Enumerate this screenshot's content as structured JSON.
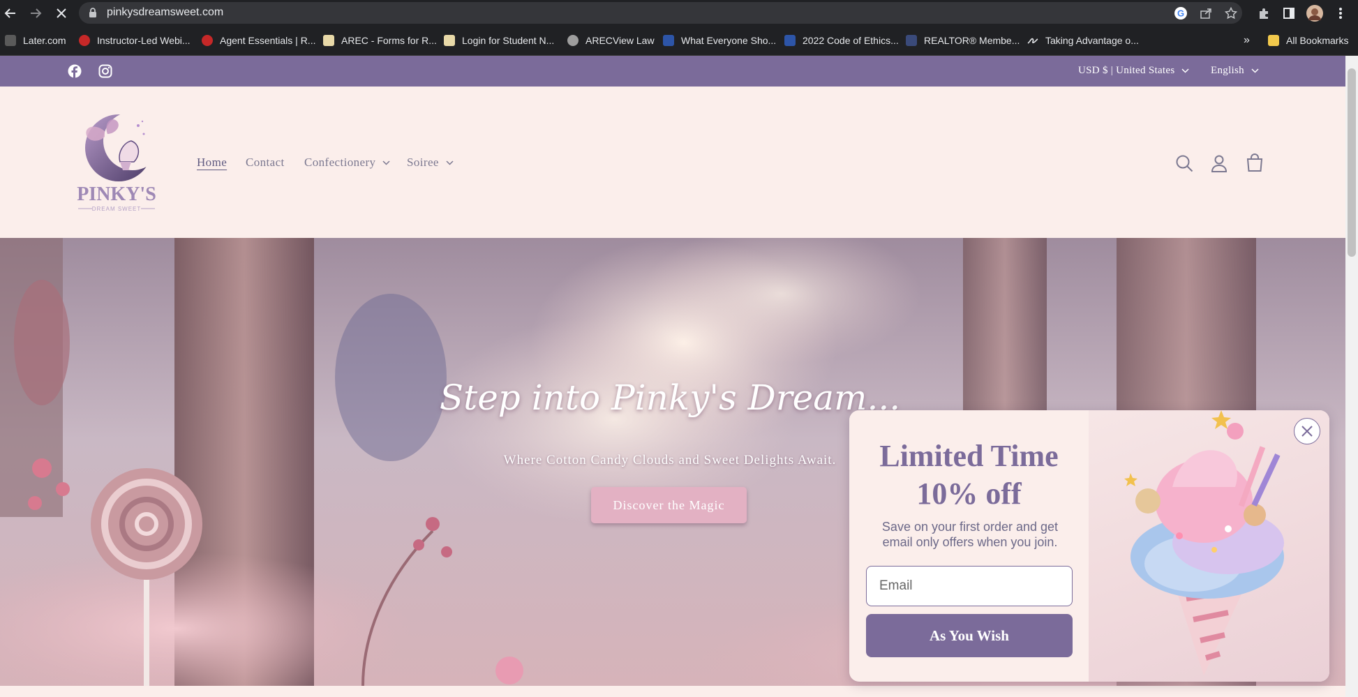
{
  "browser": {
    "url": "pinkysdreamsweet.com",
    "bookmarks": [
      {
        "label": "Later.com",
        "color": "#6b6b6b"
      },
      {
        "label": "Instructor-Led Webi...",
        "color": "#c62828"
      },
      {
        "label": "Agent Essentials | R...",
        "color": "#c62828"
      },
      {
        "label": "AREC - Forms for R...",
        "color": "#e8d9a8"
      },
      {
        "label": "Login for Student N...",
        "color": "#e8d9a8"
      },
      {
        "label": "ARECView Law",
        "color": "#9e9e9e"
      },
      {
        "label": "What Everyone Sho...",
        "color": "#2d55a8"
      },
      {
        "label": "2022 Code of Ethics...",
        "color": "#2d55a8"
      },
      {
        "label": "REALTOR® Membe...",
        "color": "#2d55a8"
      },
      {
        "label": "Taking Advantage o...",
        "color": "#e8eaed"
      }
    ],
    "more_bookmarks": "»",
    "all_bookmarks": "All Bookmarks"
  },
  "topbar": {
    "currency": "USD $ | United States",
    "language": "English"
  },
  "header": {
    "logo_text": "PINKY'S",
    "logo_subtext": "DREAM SWEET",
    "nav": [
      {
        "label": "Home"
      },
      {
        "label": "Contact"
      },
      {
        "label": "Confectionery"
      },
      {
        "label": "Soiree"
      }
    ]
  },
  "hero": {
    "title": "Step into Pinky's Dream...",
    "subtitle": "Where Cotton Candy Clouds and Sweet Delights Await.",
    "cta": "Discover the Magic"
  },
  "popup": {
    "heading_line1": "Limited Time",
    "heading_line2": "10% off",
    "description": "Save on your first order and get email only offers when you join.",
    "email_placeholder": "Email",
    "submit_label": "As You Wish"
  },
  "colors": {
    "brand_purple": "#7b6b9a",
    "cream": "#fbeeeb",
    "cta_pink": "#e3b1c3"
  }
}
